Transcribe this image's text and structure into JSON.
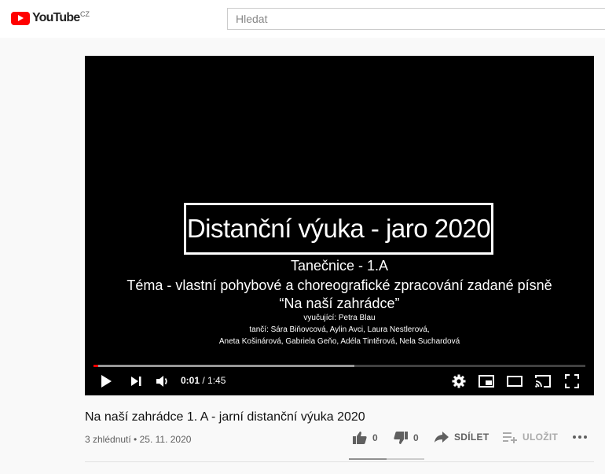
{
  "header": {
    "logo_text": "YouTube",
    "country_code": "CZ",
    "search_placeholder": "Hledat"
  },
  "player": {
    "slide_title": "Distanční výuka - jaro 2020",
    "lines": [
      "Tanečnice - 1.A",
      "Téma - vlastní pohybové a choreografické zpracování zadané písně",
      "“Na naší zahrádce”",
      "vyučující: Petra Blau",
      "tančí: Sára Biňovcová, Aylin Avci, Laura Nestlerová,",
      "Aneta Košinárová, Gabriela Geňo, Adéla Tintěrová, Nela Suchardová"
    ],
    "time_current": "0:01",
    "time_separator": " / ",
    "time_total": "1:45",
    "played_fraction": 0.0095,
    "buffered_fraction": 0.53,
    "colors": {
      "progress_played": "#ff0000"
    },
    "icons": [
      "play-icon",
      "next-icon",
      "volume-icon",
      "settings-icon",
      "miniplayer-icon",
      "theater-icon",
      "cast-icon",
      "fullscreen-icon"
    ]
  },
  "video": {
    "title": "Na naší zahrádce 1. A - jarní distanční výuka 2020",
    "views": "3 zhlédnutí",
    "separator": " • ",
    "date": "25. 11. 2020",
    "likes": "0",
    "dislikes": "0",
    "share_label": "SDÍLET",
    "save_label": "ULOŽIT",
    "sentiment_fraction": 0.5
  }
}
